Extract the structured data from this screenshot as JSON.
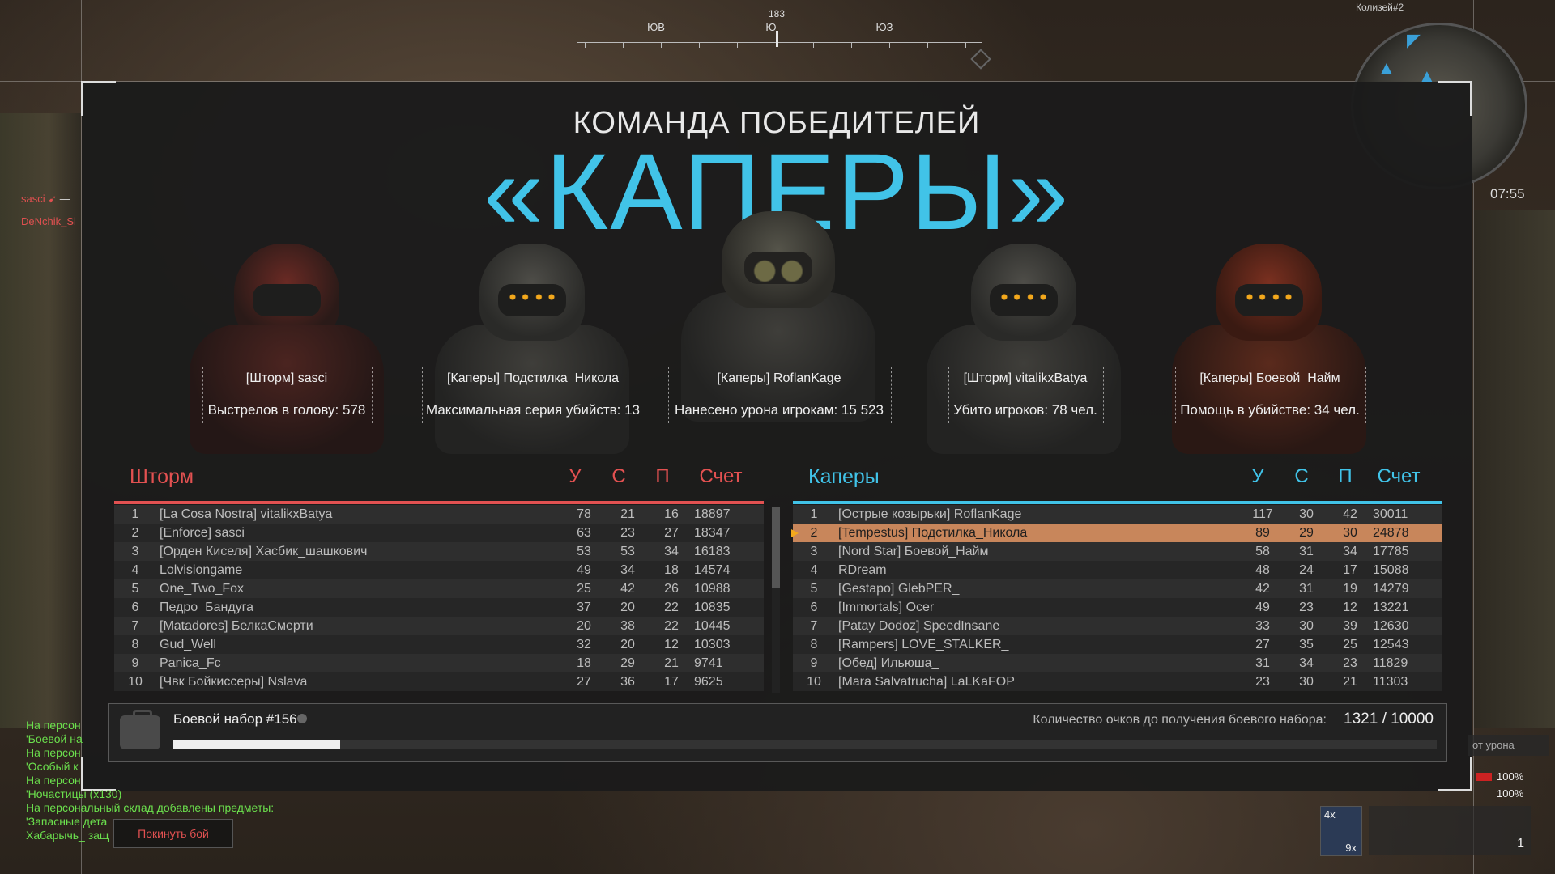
{
  "hud": {
    "compass": {
      "heading": "183",
      "labels": [
        "ЮВ",
        "Ю",
        "ЮЗ"
      ]
    },
    "map_name": "Колизей#2",
    "timer": "07:55",
    "killfeed": [
      {
        "name": "sasci",
        "sep": "—"
      },
      {
        "name": "DeNchik_Sl"
      }
    ]
  },
  "panel": {
    "title_small": "КОМАНДА ПОБЕДИТЕЛЕЙ",
    "title_big": "«КАПЕРЫ»",
    "mvps": [
      {
        "name": "[Шторм] sasci",
        "stat": "Выстрелов в голову: 578",
        "style": "red"
      },
      {
        "name": "[Каперы] Подстилка_Никола",
        "stat": "Максимальная серия убийств: 13",
        "style": "dark"
      },
      {
        "name": "[Каперы] RoflanKage",
        "stat": "Нанесено урона игрокам: 15 523",
        "style": "gas"
      },
      {
        "name": "[Шторм] vitalikxBatya",
        "stat": "Убито игроков: 78 чел.",
        "style": "dark"
      },
      {
        "name": "[Каперы] Боевой_Найм",
        "stat": "Помощь в убийстве: 34 чел.",
        "style": "rust"
      }
    ],
    "columns": {
      "k": "У",
      "d": "С",
      "a": "П",
      "score": "Счет"
    },
    "teams": {
      "storm": {
        "name": "Шторм",
        "color": "#e25151",
        "rows": [
          [
            "1",
            "[La Cosa Nostra] vitalikxBatya",
            "78",
            "21",
            "16",
            "18897"
          ],
          [
            "2",
            "[Enforce] sasci",
            "63",
            "23",
            "27",
            "18347"
          ],
          [
            "3",
            "[Орден Киселя] Хасбик_шашкович",
            "53",
            "53",
            "34",
            "16183"
          ],
          [
            "4",
            "Lolvisiongame",
            "49",
            "34",
            "18",
            "14574"
          ],
          [
            "5",
            "One_Two_Fox",
            "25",
            "42",
            "26",
            "10988"
          ],
          [
            "6",
            "Педро_Бандуга",
            "37",
            "20",
            "22",
            "10835"
          ],
          [
            "7",
            "[Matadores] БелкаСмерти",
            "20",
            "38",
            "22",
            "10445"
          ],
          [
            "8",
            "Gud_Well",
            "32",
            "20",
            "12",
            "10303"
          ],
          [
            "9",
            "Panica_Fc",
            "18",
            "29",
            "21",
            "9741"
          ],
          [
            "10",
            "[Чвк Бойкиссеры] Nslava",
            "27",
            "36",
            "17",
            "9625"
          ]
        ]
      },
      "capers": {
        "name": "Каперы",
        "color": "#41c3e8",
        "highlight_index": 1,
        "rows": [
          [
            "1",
            "[Острые козырьки] RoflanKage",
            "117",
            "30",
            "42",
            "30011"
          ],
          [
            "2",
            "[Tempestus] Подстилка_Никола",
            "89",
            "29",
            "30",
            "24878"
          ],
          [
            "3",
            "[Nord Star] Боевой_Найм",
            "58",
            "31",
            "34",
            "17785"
          ],
          [
            "4",
            "RDream",
            "48",
            "24",
            "17",
            "15088"
          ],
          [
            "5",
            "[Gestapo] GlebPER_",
            "42",
            "31",
            "19",
            "14279"
          ],
          [
            "6",
            "[Immortals] Ocer",
            "49",
            "23",
            "12",
            "13221"
          ],
          [
            "7",
            "[Patay Dodoz] SpeedInsane",
            "33",
            "30",
            "39",
            "12630"
          ],
          [
            "8",
            "[Rampers] LOVE_STALKER_",
            "27",
            "35",
            "25",
            "12543"
          ],
          [
            "9",
            "[Обед] Ильюша_",
            "31",
            "34",
            "23",
            "11829"
          ],
          [
            "10",
            "[Mara Salvatrucha] LaLKaFOP",
            "23",
            "30",
            "21",
            "11303"
          ]
        ]
      }
    },
    "kit": {
      "title": "Боевой набор #156",
      "need_label": "Количество очков до получения боевого набора:",
      "progress_text": "1321 / 10000",
      "progress_fraction": 0.1321
    }
  },
  "chat": [
    "На персон",
    "'Боевой на",
    "На персон",
    "'Особый к",
    "На персон",
    "'Ночастицы (x130)",
    "На персональный склад добавлены предметы:",
    "'Запасные дета",
    "Хабарычь_ защ"
  ],
  "leave_button": "Покинуть бой",
  "right_hud": {
    "dmg_label": "от урона",
    "hp1": "100%",
    "hp2": "100%",
    "weapon_top": "4x",
    "weapon_bottom": "9x",
    "ammo": "1"
  }
}
